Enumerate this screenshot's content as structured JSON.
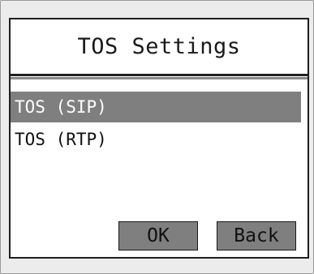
{
  "screen": {
    "title": "TOS Settings"
  },
  "list": {
    "items": [
      {
        "label": "TOS (SIP)",
        "selected": true
      },
      {
        "label": "TOS (RTP)",
        "selected": false
      }
    ]
  },
  "buttons": {
    "ok_label": "OK",
    "back_label": "Back"
  },
  "colors": {
    "selection": "#7f7f7f",
    "button": "#7f7f7f",
    "screen_bg": "#ffffff",
    "frame_bg": "#ececec"
  }
}
